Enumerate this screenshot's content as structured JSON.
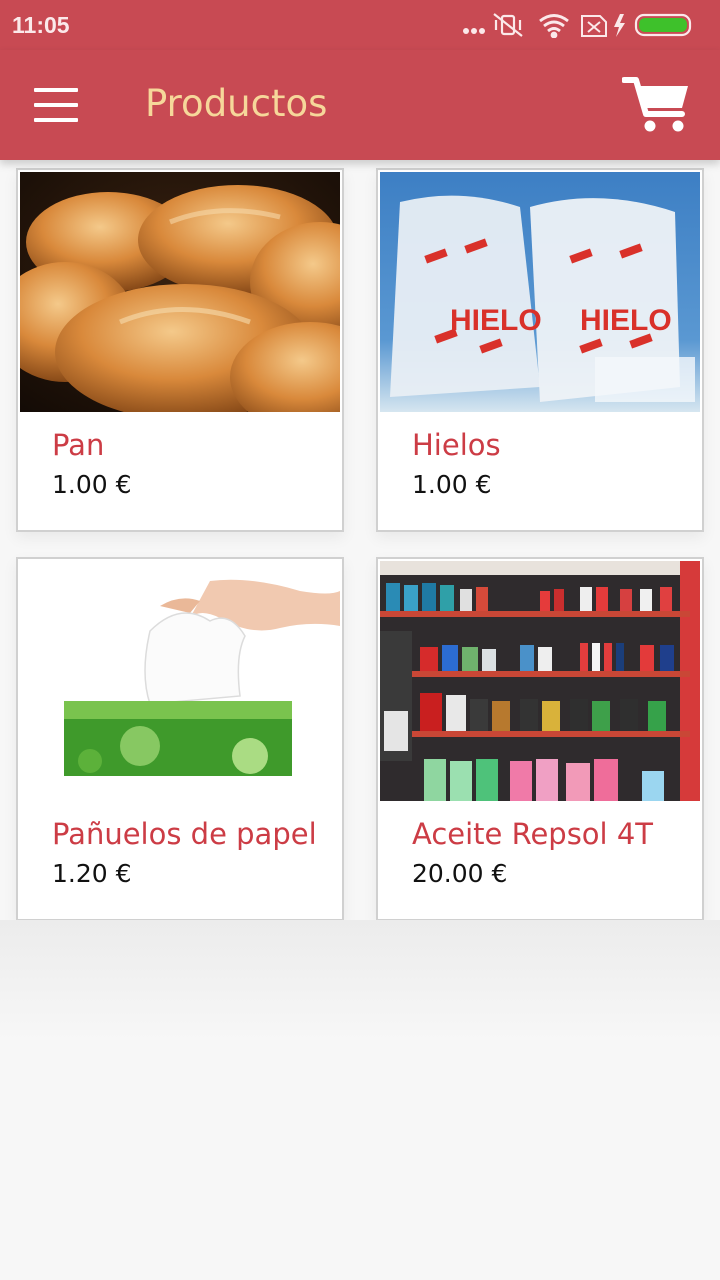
{
  "status_bar": {
    "time": "11:05",
    "icons": [
      "more-dots-icon",
      "vibrate-off-icon",
      "wifi-icon",
      "sim-x-icon",
      "charging-icon",
      "battery-full-icon"
    ],
    "battery_color": "#3ec12b"
  },
  "toolbar": {
    "title": "Productos",
    "menu_icon": "hamburger-menu-icon",
    "cart_icon": "shopping-cart-icon",
    "color": "#c84a53",
    "title_color": "#f6d79a"
  },
  "products": [
    {
      "name": "Pan",
      "price": "1.00 €",
      "image": "bread-rolls-photo"
    },
    {
      "name": "Hielos",
      "price": "1.00 €",
      "image": "ice-bags-photo"
    },
    {
      "name": "Pañuelos de papel",
      "price": "1.20 €",
      "image": "tissue-box-photo"
    },
    {
      "name": "Aceite Repsol 4T",
      "price": "20.00 €",
      "image": "oil-shelves-photo"
    }
  ],
  "colors": {
    "product_name": "#cc3c45",
    "price": "#111111"
  }
}
